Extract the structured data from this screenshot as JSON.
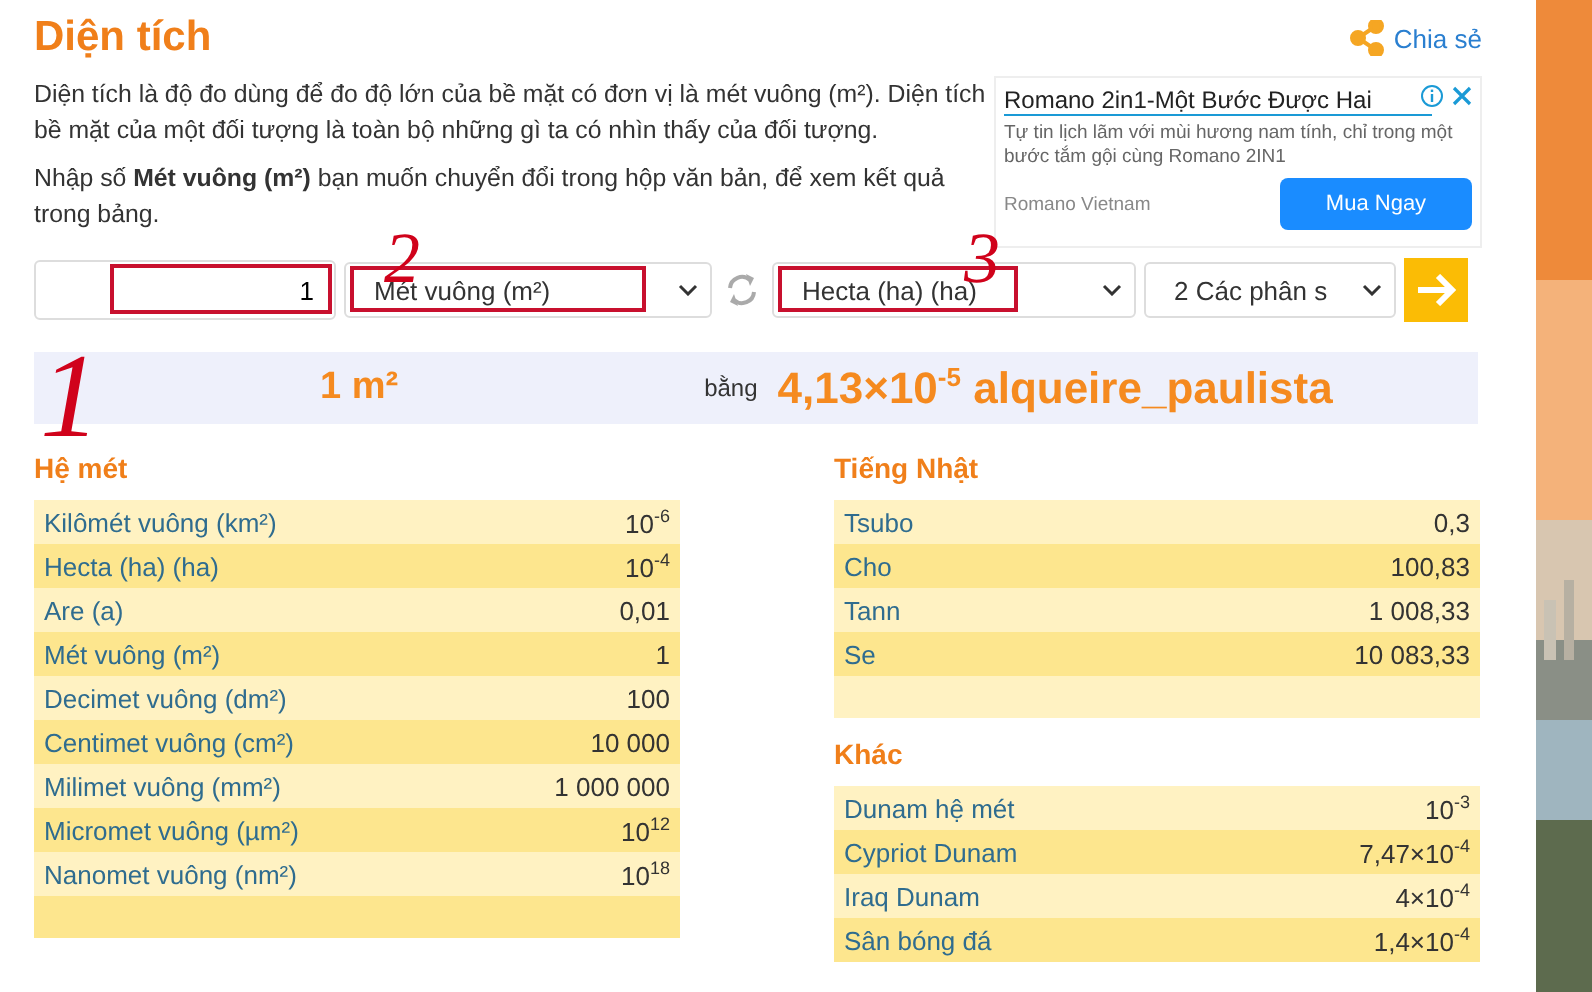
{
  "title": "Diện tích",
  "share": {
    "label": "Chia sẻ"
  },
  "intro": [
    "Diện tích là độ đo dùng để đo độ lớn của bề mặt có đơn vị là mét vuông (m²). Diện tích bề mặt của một đối tượng là toàn bộ những gì ta có nhìn thấy của đối tượng.",
    "Nhập số **Mét vuông (m²)** bạn muốn chuyển đổi trong hộp văn bản, để xem kết quả trong bảng."
  ],
  "ad": {
    "headline": "Romano 2in1-Một Bước Được Hai",
    "body": "Tự tin lịch lãm với mùi hương nam tính, chỉ trong một bước tắm gội cùng Romano 2IN1",
    "advertiser": "Romano Vietnam",
    "cta": "Mua Ngay"
  },
  "converter": {
    "value": "1",
    "value_highlighted": true,
    "from_unit": "Mét vuông (m²)",
    "from_highlighted": true,
    "to_unit": "Hecta (ha) (ha)",
    "to_highlighted": true,
    "decimals": "2 Các phân s"
  },
  "result": {
    "input": "1 m²",
    "equals": "bằng",
    "output": "4,13×10$^{-5}$ alqueire_paulista"
  },
  "annotations": [
    "1",
    "2",
    "3"
  ],
  "columns": [
    [
      {
        "heading": "Hệ mét",
        "rows": [
          {
            "unit": "Kilômét vuông (km²)",
            "value": "10$^{-6}$"
          },
          {
            "unit": "Hecta (ha) (ha)",
            "value": "10$^{-4}$"
          },
          {
            "unit": "Are (a)",
            "value": "0,01"
          },
          {
            "unit": "Mét vuông (m²)",
            "value": "1"
          },
          {
            "unit": "Decimet vuông (dm²)",
            "value": "100"
          },
          {
            "unit": "Centimet vuông (cm²)",
            "value": "10 000"
          },
          {
            "unit": "Milimet vuông (mm²)",
            "value": "1 000 000"
          },
          {
            "unit": "Micromet vuông (µm²)",
            "value": "10$^{12}$"
          },
          {
            "unit": "Nanomet vuông (nm²)",
            "value": "10$^{18}$"
          }
        ]
      }
    ],
    [
      {
        "heading": "Tiếng Nhật",
        "rows": [
          {
            "unit": "Tsubo",
            "value": "0,3"
          },
          {
            "unit": "Cho",
            "value": "100,83"
          },
          {
            "unit": "Tann",
            "value": "1 008,33"
          },
          {
            "unit": "Se",
            "value": "10 083,33"
          }
        ]
      },
      {
        "heading": "Khác",
        "rows": [
          {
            "unit": "Dunam hệ mét",
            "value": "10$^{-3}$"
          },
          {
            "unit": "Cypriot Dunam",
            "value": "7,47×10$^{-4}$"
          },
          {
            "unit": "Iraq Dunam",
            "value": "4×10$^{-4}$"
          },
          {
            "unit": "Sân bóng đá",
            "value": "1,4×10$^{-4}$"
          }
        ]
      }
    ]
  ]
}
